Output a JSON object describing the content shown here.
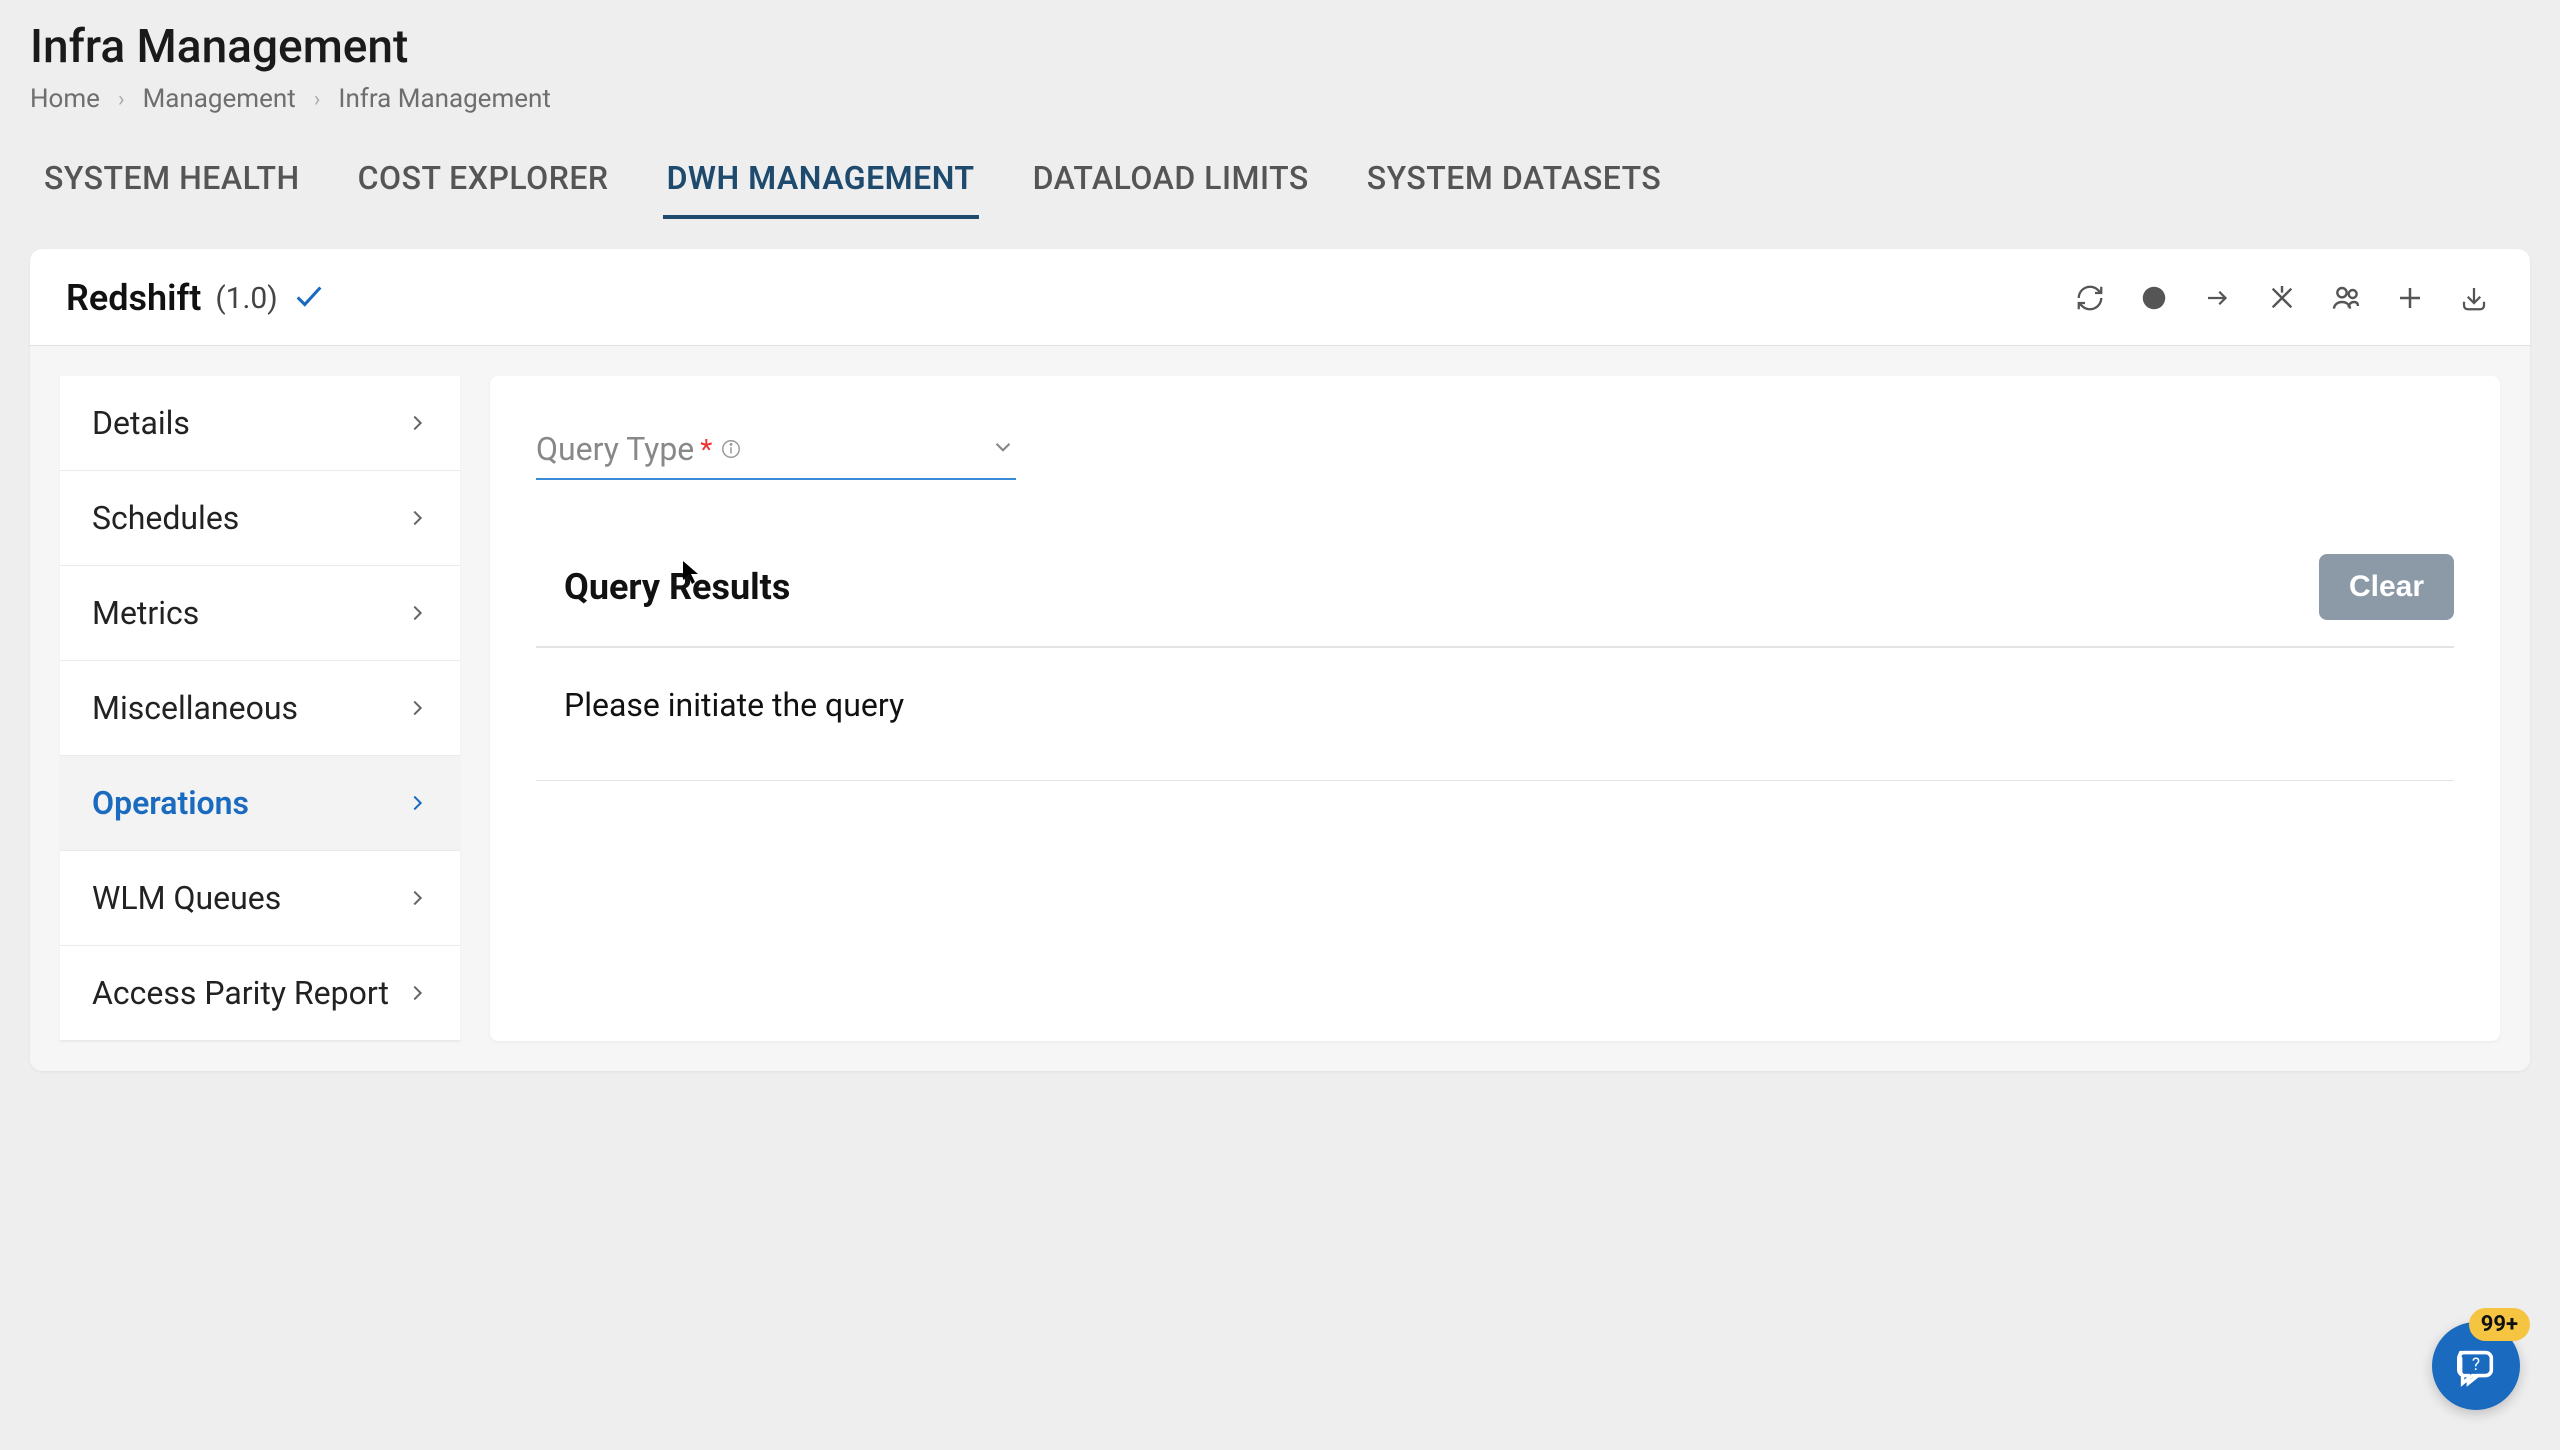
{
  "page": {
    "title": "Infra Management"
  },
  "breadcrumbs": {
    "items": [
      "Home",
      "Management",
      "Infra Management"
    ]
  },
  "tabs": {
    "items": [
      {
        "label": "SYSTEM HEALTH",
        "active": false
      },
      {
        "label": "COST EXPLORER",
        "active": false
      },
      {
        "label": "DWH MANAGEMENT",
        "active": true
      },
      {
        "label": "DATALOAD LIMITS",
        "active": false
      },
      {
        "label": "SYSTEM DATASETS",
        "active": false
      }
    ]
  },
  "card": {
    "title": "Redshift",
    "version": "(1.0)"
  },
  "sidebar": {
    "items": [
      {
        "label": "Details",
        "active": false
      },
      {
        "label": "Schedules",
        "active": false
      },
      {
        "label": "Metrics",
        "active": false
      },
      {
        "label": "Miscellaneous",
        "active": false
      },
      {
        "label": "Operations",
        "active": true
      },
      {
        "label": "WLM Queues",
        "active": false
      },
      {
        "label": "Access Parity Report",
        "active": false
      }
    ]
  },
  "form": {
    "query_type_label": "Query Type",
    "required_marker": "*"
  },
  "results": {
    "title": "Query Results",
    "clear_label": "Clear",
    "message": "Please initiate the query"
  },
  "chat": {
    "badge": "99+"
  }
}
